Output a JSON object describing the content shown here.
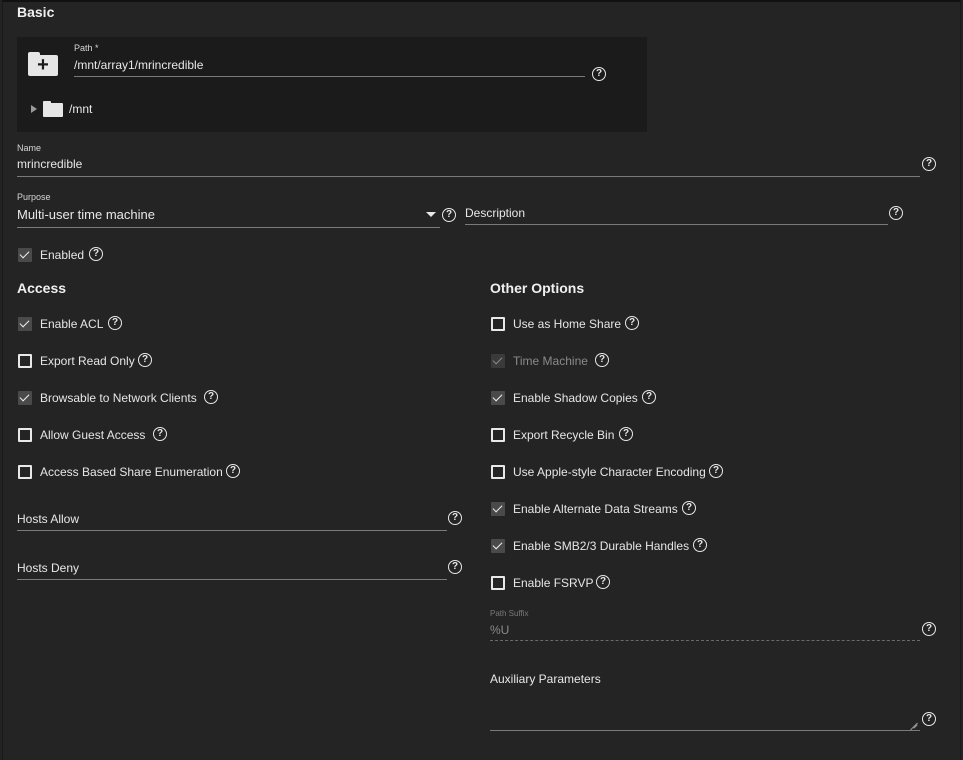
{
  "basic": {
    "heading": "Basic",
    "path": {
      "label": "Path *",
      "value": "/mnt/array1/mrincredible"
    },
    "tree": {
      "root": "/mnt"
    },
    "name": {
      "label": "Name",
      "value": "mrincredible"
    },
    "purpose": {
      "label": "Purpose",
      "value": "Multi-user time machine"
    },
    "description": {
      "placeholder": "Description"
    },
    "enabled": {
      "label": "Enabled",
      "checked": true
    }
  },
  "access": {
    "heading": "Access",
    "options": [
      {
        "label": "Enable ACL",
        "checked": true
      },
      {
        "label": "Export Read Only",
        "checked": false
      },
      {
        "label": "Browsable to Network Clients",
        "checked": true
      },
      {
        "label": "Allow Guest Access",
        "checked": false
      },
      {
        "label": "Access Based Share Enumeration",
        "checked": false
      }
    ],
    "hosts_allow": {
      "placeholder": "Hosts Allow"
    },
    "hosts_deny": {
      "placeholder": "Hosts Deny"
    }
  },
  "other": {
    "heading": "Other Options",
    "options": [
      {
        "label": "Use as Home Share",
        "checked": false,
        "disabled": false
      },
      {
        "label": "Time Machine",
        "checked": true,
        "disabled": true
      },
      {
        "label": "Enable Shadow Copies",
        "checked": true,
        "disabled": false
      },
      {
        "label": "Export Recycle Bin",
        "checked": false,
        "disabled": false
      },
      {
        "label": "Use Apple-style Character Encoding",
        "checked": false,
        "disabled": false
      },
      {
        "label": "Enable Alternate Data Streams",
        "checked": true,
        "disabled": false
      },
      {
        "label": "Enable SMB2/3 Durable Handles",
        "checked": true,
        "disabled": false
      },
      {
        "label": "Enable FSRVP",
        "checked": false,
        "disabled": false
      }
    ],
    "path_suffix": {
      "label": "Path Suffix",
      "value": "%U"
    },
    "aux": {
      "label": "Auxiliary Parameters"
    }
  },
  "icons": {
    "help": "?"
  }
}
